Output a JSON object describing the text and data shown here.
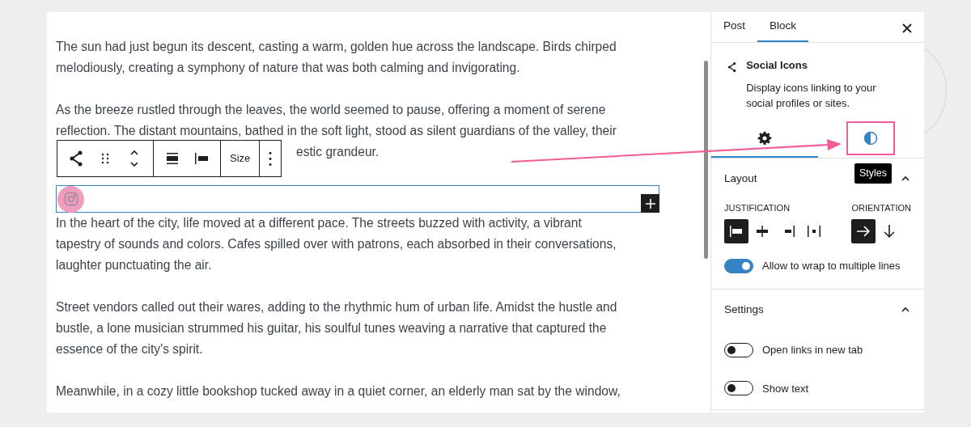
{
  "editor": {
    "paragraphs": [
      {
        "lines": [
          "The sun had just begun its descent, casting a warm, golden hue across the landscape. Birds chirped",
          "melodiously, creating a symphony of nature that was both calming and invigorating."
        ]
      },
      {
        "lines": [
          "As the breeze rustled through the leaves, the world seemed to pause, offering a moment of serene",
          "reflection. The distant mountains, bathed in the soft light, stood as silent guardians of the valley, their"
        ],
        "tail": "estic grandeur."
      },
      {
        "kind": "social"
      },
      {
        "lines": [
          "In the heart of the city, life moved at a different pace. The streets buzzed with activity, a vibrant",
          "tapestry of sounds and colors. Cafes spilled over with patrons, each absorbed in their conversations,",
          "laughter punctuating the air."
        ]
      },
      {
        "lines": [
          "Street vendors called out their wares, adding to the rhythmic hum of urban life. Amidst the hustle and",
          "bustle, a lone musician strummed his guitar, his soulful tunes weaving a narrative that captured the",
          "essence of the city's spirit."
        ]
      },
      {
        "lines": [
          "Meanwhile, in a cozy little bookshop tucked away in a quiet corner, an elderly man sat by the window,"
        ]
      }
    ],
    "toolbar": [
      [
        {
          "kind": "share"
        },
        {
          "kind": "drag"
        },
        {
          "kind": "move"
        }
      ],
      [
        {
          "kind": "justify"
        },
        {
          "kind": "width"
        }
      ],
      [
        {
          "kind": "text",
          "label": "Size"
        }
      ],
      [
        {
          "kind": "more"
        }
      ]
    ],
    "social_block": {
      "selected": true
    }
  },
  "sidebar": {
    "tabs": [
      {
        "label": "Post",
        "selected": false
      },
      {
        "label": "Block",
        "selected": true
      }
    ],
    "block_card": {
      "title": "Social Icons",
      "description": "Display icons linking to your social profiles or sites."
    },
    "inspector_tabs": [
      {
        "kind": "settings",
        "selected": true,
        "highlighted": false
      },
      {
        "kind": "styles",
        "selected": false,
        "highlighted": true
      }
    ],
    "tooltip": "Styles",
    "panels": [
      {
        "title": "Layout",
        "expanded": true,
        "groups": [
          {
            "label": "JUSTIFICATION",
            "options": [
              {
                "kind": "left",
                "selected": true
              },
              {
                "kind": "center",
                "selected": false
              },
              {
                "kind": "right",
                "selected": false
              },
              {
                "kind": "space-between",
                "selected": false
              }
            ]
          },
          {
            "label": "ORIENTATION",
            "options": [
              {
                "kind": "horizontal",
                "selected": true
              },
              {
                "kind": "vertical",
                "selected": false
              }
            ]
          }
        ],
        "toggles": [
          {
            "label": "Allow to wrap to multiple lines",
            "on": true
          }
        ]
      },
      {
        "title": "Settings",
        "expanded": true,
        "toggles": [
          {
            "label": "Open links in new tab",
            "on": false
          },
          {
            "label": "Show text",
            "on": false
          }
        ]
      }
    ]
  }
}
